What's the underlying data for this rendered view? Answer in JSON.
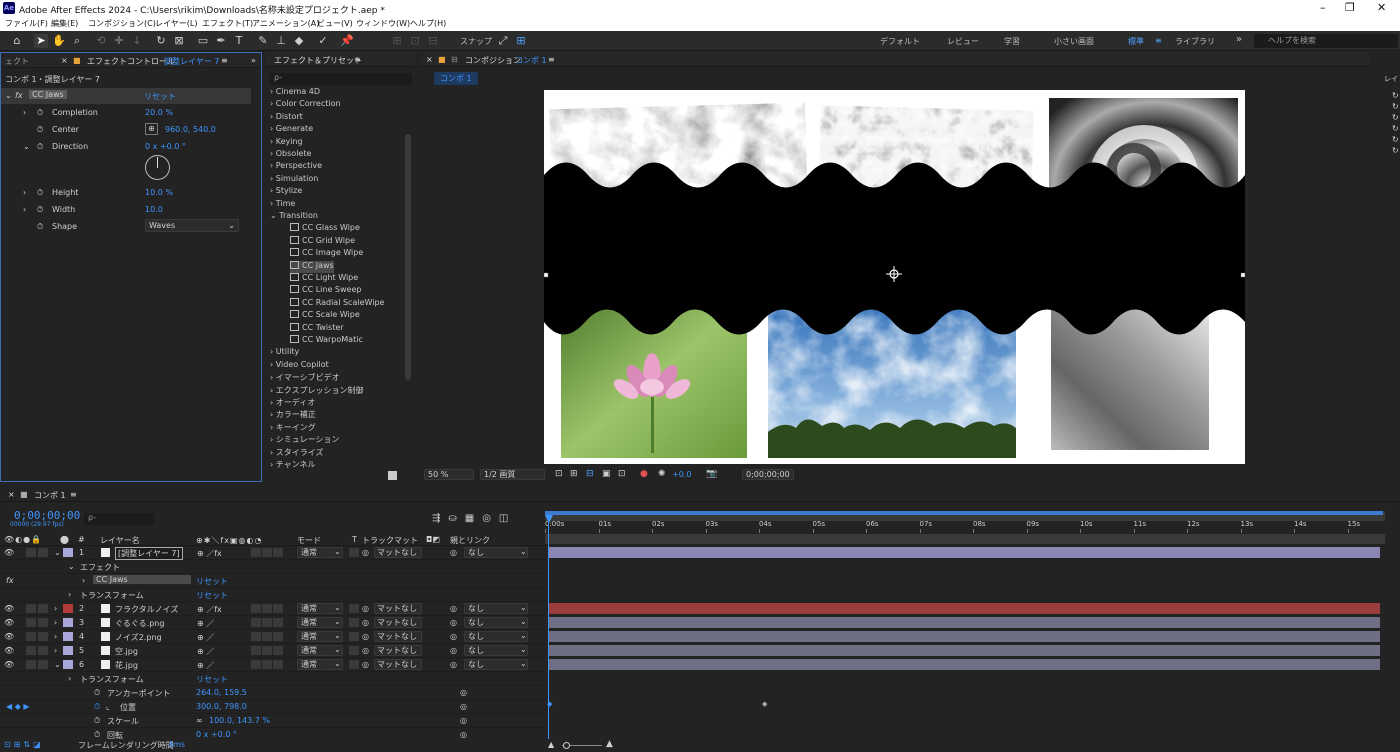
{
  "app": {
    "title": "Adobe After Effects 2024 - C:\\Users\\rikim\\Downloads\\名称未設定プロジェクト.aep *",
    "icon": "Ae"
  },
  "menu": [
    "ファイル(F)",
    "編集(E)",
    "コンポジション(C)",
    "レイヤー(L)",
    "エフェクト(T)",
    "アニメーション(A)",
    "ビュー(V)",
    "ウィンドウ(W)",
    "ヘルプ(H)"
  ],
  "toolbar": {
    "snap": "スナップ",
    "workspaces": [
      "デフォルト",
      "レビュー",
      "学習",
      "小さい画面",
      "標準",
      "ライブラリ"
    ],
    "active_workspace": "標準",
    "help_placeholder": "ヘルプを検索"
  },
  "fx_panel": {
    "tab_left": "ェクト",
    "tab": "エフェクトコントロール",
    "tab_layer": "調整レイヤー 7",
    "subtitle": "コンポ 1・調整レイヤー 7",
    "effect_name": "CC Jaws",
    "reset": "リセット",
    "props": [
      {
        "name": "Completion",
        "value": "20.0 %"
      },
      {
        "name": "Center",
        "value": "960.0, 540.0"
      },
      {
        "name": "Direction",
        "value": "0 x +0.0 °"
      },
      {
        "name": "Height",
        "value": "10.0 %"
      },
      {
        "name": "Width",
        "value": "10.0"
      },
      {
        "name": "Shape",
        "value": "Waves"
      }
    ]
  },
  "presets": {
    "tab": "エフェクト＆プリセット",
    "search_placeholder": "ρ-",
    "categories": [
      "Cinema 4D",
      "Color Correction",
      "Distort",
      "Generate",
      "Keying",
      "Obsolete",
      "Perspective",
      "Simulation",
      "Stylize",
      "Time",
      "Transition"
    ],
    "transition_items": [
      "CC Glass Wipe",
      "CC Grid Wipe",
      "CC Image Wipe",
      "CC Jaws",
      "CC Light Wipe",
      "CC Line Sweep",
      "CC Radial ScaleWipe",
      "CC Scale Wipe",
      "CC Twister",
      "CC WarpoMatic"
    ],
    "selected": "CC Jaws",
    "more": [
      "Utility",
      "Video Copilot",
      "イマーシブビデオ",
      "エクスプレッション制御",
      "オーディオ",
      "カラー補正",
      "キーイング",
      "シミュレーション",
      "スタイライズ",
      "チャンネル"
    ]
  },
  "comp": {
    "tab": "コンポジション",
    "tab_name": "コンポ 1",
    "subtab": "コンポ 1",
    "zoom": "50 %",
    "resolution": "1/2 画質",
    "exposure": "+0.0",
    "timecode": "0;00;00;00"
  },
  "right_strip": {
    "label": "レイ"
  },
  "timeline": {
    "tab": "コンポ 1",
    "timecode": "0;00;00;00",
    "fps": "00000 (29.97 fps)",
    "search_placeholder": "ρ-",
    "headers": {
      "name": "レイヤー名",
      "mode": "モード",
      "t": "T",
      "trackmatte": "トラックマット",
      "parent": "親とリンク"
    },
    "ruler": [
      "0:00s",
      "01s",
      "02s",
      "03s",
      "04s",
      "05s",
      "06s",
      "07s",
      "08s",
      "09s",
      "10s",
      "11s",
      "12s",
      "13s",
      "14s",
      "15s"
    ],
    "layers": [
      {
        "num": "1",
        "name": "[調整レイヤー 7]",
        "mode": "通常",
        "matte": "マットなし",
        "parent": "なし",
        "color": "#a9a7d9",
        "bar": "#8a87b5"
      },
      {
        "num": "2",
        "name": "フラクタルノイズ",
        "mode": "通常",
        "matte": "マットなし",
        "parent": "なし",
        "color": "#b23a3a",
        "bar": "#9a3d3d"
      },
      {
        "num": "3",
        "name": "ぐるぐる.png",
        "mode": "通常",
        "matte": "マットなし",
        "parent": "なし",
        "color": "#a9a7d9",
        "bar": "#6e6e84"
      },
      {
        "num": "4",
        "name": "ノイズ2.png",
        "mode": "通常",
        "matte": "マットなし",
        "parent": "なし",
        "color": "#a9a7d9",
        "bar": "#6e6e84"
      },
      {
        "num": "5",
        "name": "空.jpg",
        "mode": "通常",
        "matte": "マットなし",
        "parent": "なし",
        "color": "#a9a7d9",
        "bar": "#6e6e84"
      },
      {
        "num": "6",
        "name": "花.jpg",
        "mode": "通常",
        "matte": "マットなし",
        "parent": "なし",
        "color": "#a9a7d9",
        "bar": "#6e6e84"
      }
    ],
    "effect_group": "エフェクト",
    "effect_item": "CC Jaws",
    "transform": "トランスフォーム",
    "reset": "リセット",
    "props": [
      {
        "name": "アンカーポイント",
        "value": "264.0, 159.5"
      },
      {
        "name": "位置",
        "value": "300.0, 798.0"
      },
      {
        "name": "スケール",
        "value": "100.0, 143.7 %"
      },
      {
        "name": "回転",
        "value": "0 x +0.0 °"
      }
    ],
    "footer": {
      "label": "フレームレンダリング時間",
      "value": "4ms"
    }
  }
}
